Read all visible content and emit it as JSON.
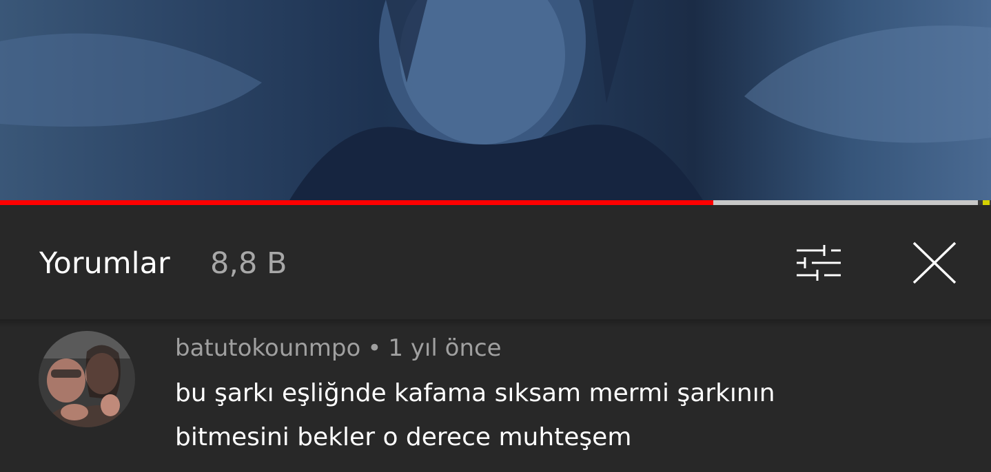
{
  "video": {
    "progress_played": 0.72,
    "progress_buffered": 0.987
  },
  "comments_panel": {
    "title": "Yorumlar",
    "count": "8,8 B",
    "icons": {
      "filter": "sliders-icon",
      "close": "close-icon"
    }
  },
  "comment": {
    "author": "batutokounmpo",
    "separator": "•",
    "time": "1 yıl önce",
    "text_line1": "bu şarkı eşliğnde kafama sıksam mermi şarkının",
    "text_line2": "bitmesini bekler o derece muhteşem",
    "avatar_icon": "avatar-photo"
  },
  "colors": {
    "accent": "#ff0000",
    "background": "#282828",
    "marker": "#d4d100"
  }
}
